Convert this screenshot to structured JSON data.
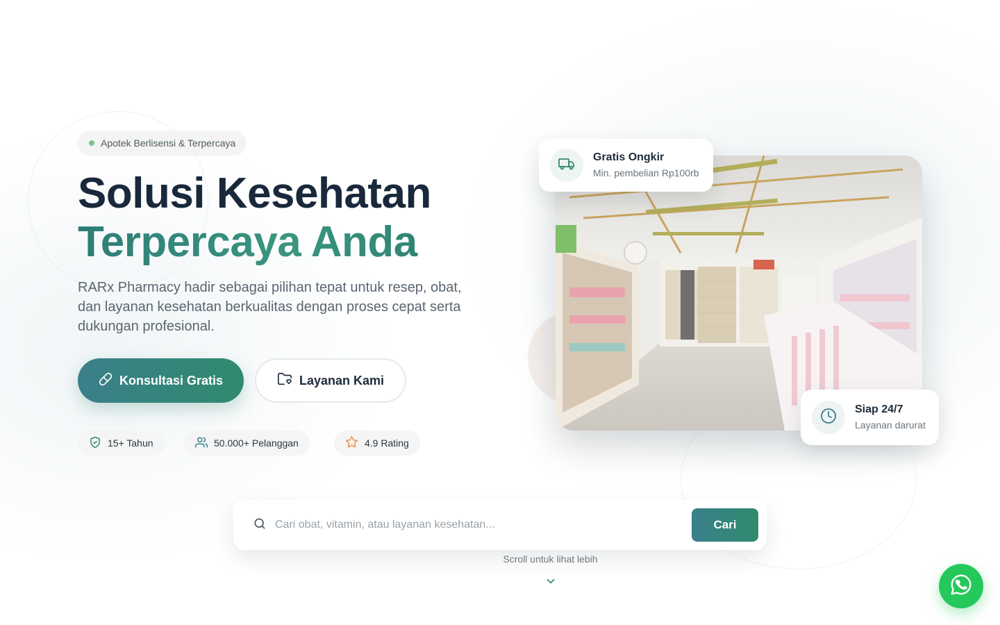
{
  "hero": {
    "badge": "Apotek Berlisensi & Terpercaya",
    "headline_line1": "Solusi Kesehatan",
    "headline_line2": "Terpercaya Anda",
    "description": "RARx Pharmacy hadir sebagai pilihan tepat untuk resep, obat, dan layanan kesehatan berkualitas dengan proses cepat serta dukungan profesional.",
    "primary_button": "Konsultasi Gratis",
    "secondary_button": "Layanan Kami",
    "stats": [
      {
        "icon": "shield-check-icon",
        "label": "15+ Tahun"
      },
      {
        "icon": "users-icon",
        "label": "50.000+ Pelanggan"
      },
      {
        "icon": "star-icon",
        "label": "4.9 Rating"
      }
    ]
  },
  "cards": {
    "shipping": {
      "title": "Gratis Ongkir",
      "subtitle": "Min. pembelian Rp100rb",
      "icon": "truck-icon"
    },
    "support": {
      "title": "Siap 24/7",
      "subtitle": "Layanan darurat",
      "icon": "clock-icon"
    }
  },
  "search": {
    "placeholder": "Cari obat, vitamin, atau layanan kesehatan...",
    "button": "Cari"
  },
  "scroll_hint": "Scroll untuk lihat lebih",
  "colors": {
    "brand_teal": "#2f8a6e",
    "brand_teal_dark": "#3a7f8a",
    "heading_dark": "#19283a",
    "whatsapp_green": "#25c85b",
    "star_orange": "#e8955a"
  }
}
